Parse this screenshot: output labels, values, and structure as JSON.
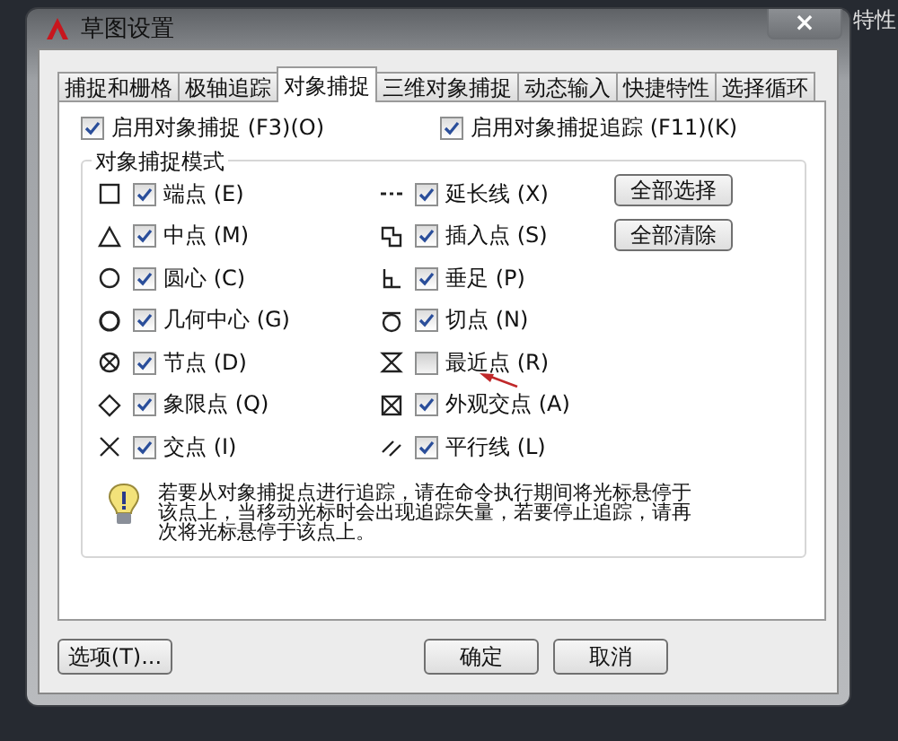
{
  "background_label": "特性",
  "window": {
    "title": "草图设置",
    "close": "×"
  },
  "tabs": [
    {
      "label": "捕捉和栅格",
      "selected": false
    },
    {
      "label": "极轴追踪",
      "selected": false
    },
    {
      "label": "对象捕捉",
      "selected": true
    },
    {
      "label": "三维对象捕捉",
      "selected": false
    },
    {
      "label": "动态输入",
      "selected": false
    },
    {
      "label": "快捷特性",
      "selected": false
    },
    {
      "label": "选择循环",
      "selected": false
    }
  ],
  "toggles": [
    {
      "label": "启用对象捕捉 (F3)(O)",
      "checked": true
    },
    {
      "label": "启用对象捕捉追踪 (F11)(K)",
      "checked": true
    }
  ],
  "snap_modes": {
    "title": "对象捕捉模式",
    "left": [
      {
        "kind": "endpoint",
        "label": "端点 (E)",
        "checked": true
      },
      {
        "kind": "midpoint",
        "label": "中点 (M)",
        "checked": true
      },
      {
        "kind": "center",
        "label": "圆心 (C)",
        "checked": true
      },
      {
        "kind": "geocenter",
        "label": "几何中心 (G)",
        "checked": true
      },
      {
        "kind": "node",
        "label": "节点 (D)",
        "checked": true
      },
      {
        "kind": "quadrant",
        "label": "象限点 (Q)",
        "checked": true
      },
      {
        "kind": "intersection",
        "label": "交点 (I)",
        "checked": true
      }
    ],
    "right": [
      {
        "kind": "extension",
        "label": "延长线 (X)",
        "checked": true
      },
      {
        "kind": "insertion",
        "label": "插入点 (S)",
        "checked": true
      },
      {
        "kind": "perpendicular",
        "label": "垂足 (P)",
        "checked": true
      },
      {
        "kind": "tangent",
        "label": "切点 (N)",
        "checked": true
      },
      {
        "kind": "nearest",
        "label": "最近点 (R)",
        "checked": false
      },
      {
        "kind": "apparent",
        "label": "外观交点 (A)",
        "checked": true
      },
      {
        "kind": "parallel",
        "label": "平行线 (L)",
        "checked": true
      }
    ],
    "buttons": [
      "全部选择",
      "全部清除"
    ],
    "hint": "若要从对象捕捉点进行追踪，请在命令执行期间将光标悬停于该点上，当移动光标时会出现追踪矢量，若要停止追踪，请再次将光标悬停于该点上。"
  },
  "footer": {
    "options": "选项(T)...",
    "ok": "确定",
    "cancel": "取消"
  }
}
